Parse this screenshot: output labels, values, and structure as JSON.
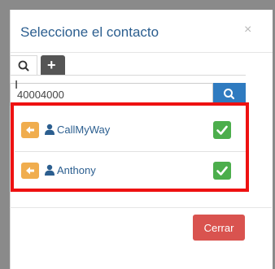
{
  "modal": {
    "title": "Seleccione el contacto",
    "close_symbol": "×"
  },
  "tabs": [
    {
      "icon": "search-icon"
    },
    {
      "icon": "plus-icon",
      "label": "+"
    }
  ],
  "search": {
    "value": "40004000",
    "button_icon": "search-icon"
  },
  "contacts": [
    {
      "name": "CallMyWay"
    },
    {
      "name": "Anthony"
    }
  ],
  "footer": {
    "close_label": "Cerrar"
  },
  "colors": {
    "title": "#2b5e8f",
    "search_button": "#2f7bc0",
    "arrow_button": "#f0ad4e",
    "check_button": "#4cae4c",
    "close_button": "#d9534f",
    "highlight": "#ee1111"
  }
}
